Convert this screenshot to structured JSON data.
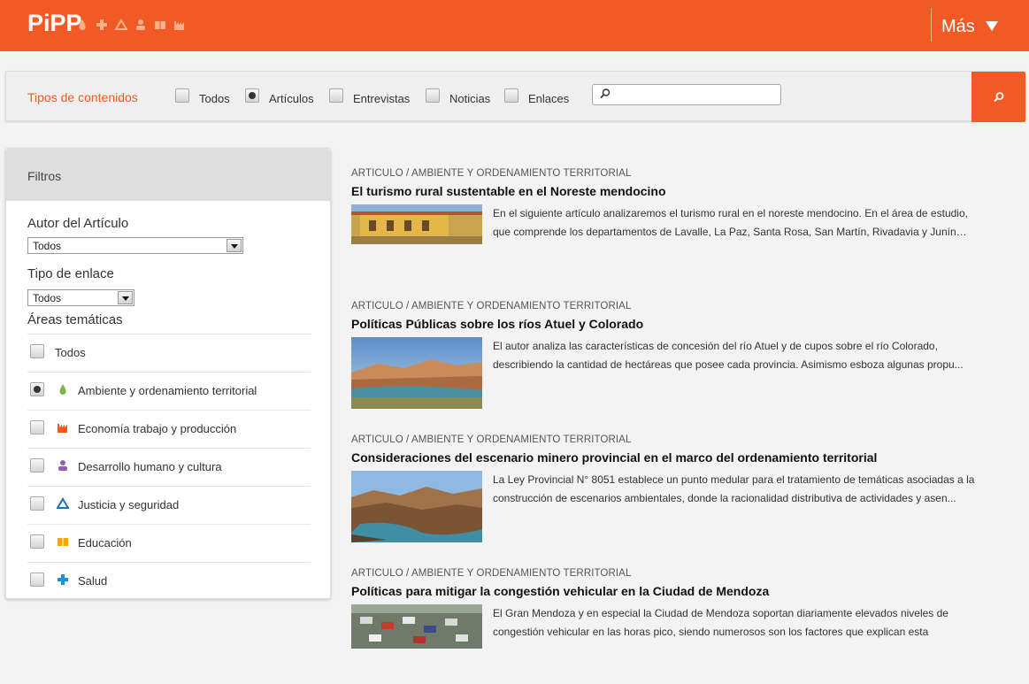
{
  "header": {
    "logo": "PiPP",
    "icons": [
      "drop-icon",
      "cross-icon",
      "triangle-icon",
      "person-icon",
      "book-icon",
      "factory-icon"
    ],
    "more_label": "Más",
    "accent": "#f15a24"
  },
  "content_types": {
    "title": "Tipos de contenidos",
    "options": [
      {
        "label": "Todos",
        "checked": false
      },
      {
        "label": "Artículos",
        "checked": true
      },
      {
        "label": "Entrevistas",
        "checked": false
      },
      {
        "label": "Noticias",
        "checked": false
      },
      {
        "label": "Enlaces",
        "checked": false
      }
    ],
    "search_value": ""
  },
  "filters": {
    "title": "Filtros",
    "author": {
      "label": "Autor del Artículo",
      "value": "Todos"
    },
    "link_type": {
      "label": "Tipo de enlace",
      "value": "Todos"
    },
    "areas": {
      "label": "Áreas temáticas",
      "items": [
        {
          "label": "Todos",
          "icon": "",
          "checked": false
        },
        {
          "label": "Ambiente y ordenamiento territorial",
          "icon": "drop-icon",
          "color": "#7ab648",
          "checked": true
        },
        {
          "label": "Economía trabajo y producción",
          "icon": "factory-icon",
          "color": "#f15a24",
          "checked": false
        },
        {
          "label": "Desarrollo humano y cultura",
          "icon": "person-icon",
          "color": "#9b59b6",
          "checked": false
        },
        {
          "label": "Justicia y seguridad",
          "icon": "triangle-icon",
          "color": "#1f6fb5",
          "checked": false
        },
        {
          "label": "Educación",
          "icon": "book-icon",
          "color": "#f7a600",
          "checked": false
        },
        {
          "label": "Salud",
          "icon": "cross-icon",
          "color": "#1e90d6",
          "checked": false
        }
      ]
    }
  },
  "articles": [
    {
      "category": "ARTICULO / AMBIENTE Y ORDENAMIENTO TERRITORIAL",
      "title": "El turismo rural sustentable en el Noreste mendocino",
      "excerpt_1": "En el siguiente artículo analizaremos el turismo rural en el noreste mendocino. En el área de estudio,",
      "excerpt_2": "que comprende los departamentos de Lavalle, La Paz, Santa Rosa, San Martín, Rivadavia y Junín…"
    },
    {
      "category": "ARTICULO / AMBIENTE Y ORDENAMIENTO TERRITORIAL",
      "title": "Políticas Públicas sobre los ríos Atuel y Colorado",
      "excerpt_1": "El autor analiza las características de concesión del río Atuel y de cupos sobre el río Colorado,",
      "excerpt_2": "describiendo la cantidad de hectáreas que posee cada provincia.  Asimismo esboza algunas propu..."
    },
    {
      "category": "ARTICULO / AMBIENTE Y ORDENAMIENTO TERRITORIAL",
      "title": "Consideraciones del escenario minero provincial en el marco del ordenamiento territorial",
      "excerpt_1": "La Ley Provincial N° 8051 establece un punto medular para el tratamiento de temáticas asociadas a la",
      "excerpt_2": "construcción de escenarios ambientales, donde la racionalidad distributiva de actividades y asen..."
    },
    {
      "category": "ARTICULO / AMBIENTE Y ORDENAMIENTO TERRITORIAL",
      "title": "Políticas para mitigar la congestión vehicular en la Ciudad de Mendoza",
      "excerpt_1": "El Gran Mendoza y en especial la Ciudad de Mendoza soportan diariamente elevados niveles de",
      "excerpt_2": "congestión vehicular en las horas pico, siendo numerosos son los factores que explican esta"
    }
  ]
}
